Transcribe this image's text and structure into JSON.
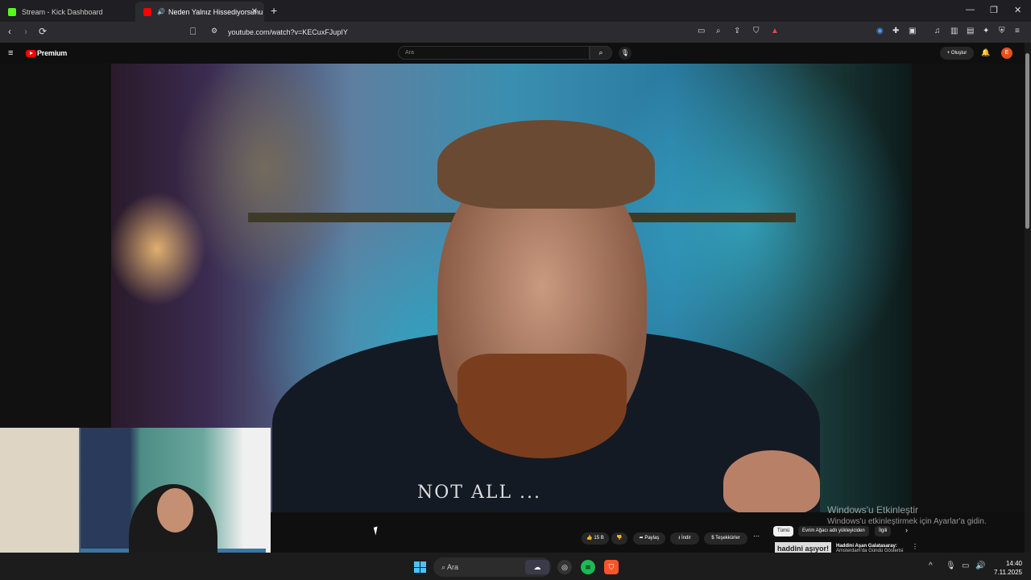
{
  "browser": {
    "tabs": [
      {
        "title": "Stream - Kick Dashboard",
        "active": false,
        "favicon_color": "#53fc18"
      },
      {
        "title": "Neden Yalnız Hissediyorsunu",
        "active": true,
        "favicon_color": "#ff0000"
      }
    ],
    "new_tab_icon": "plus-icon",
    "url": "youtube.com/watch?v=KECuxFJupIY"
  },
  "youtube": {
    "logo_text": "Premium",
    "search_placeholder": "Ara",
    "create_label": "Oluştur",
    "avatar_letter": "E",
    "actions": {
      "like_count": "15 B",
      "share_label": "Paylaş",
      "download_label": "İndir",
      "thanks_label": "Teşekkürler"
    },
    "chips": [
      "Tümü",
      "Evrim Ağacı adlı yükleyiciden",
      "İlgili"
    ],
    "recommendation": {
      "thumb_text": "haddini aşıyor!",
      "title": "Haddini Aşan Galatasaray:",
      "subtitle": "Amsterdam'da Gündü Gösterisi"
    },
    "video_shirt_text": "NOT ALL ..."
  },
  "watermark": {
    "line1": "Windows'u Etkinleştir",
    "line2": "Windows'u etkinleştirmek için Ayarlar'a gidin."
  },
  "taskbar": {
    "search_label": "Ara",
    "time": "14:40",
    "date": "7.11.2025"
  },
  "colors": {
    "youtube_red": "#ff0000",
    "spotify_green": "#1db954",
    "brave_orange": "#fb542b",
    "windows_blue": "#4cc2ff"
  }
}
